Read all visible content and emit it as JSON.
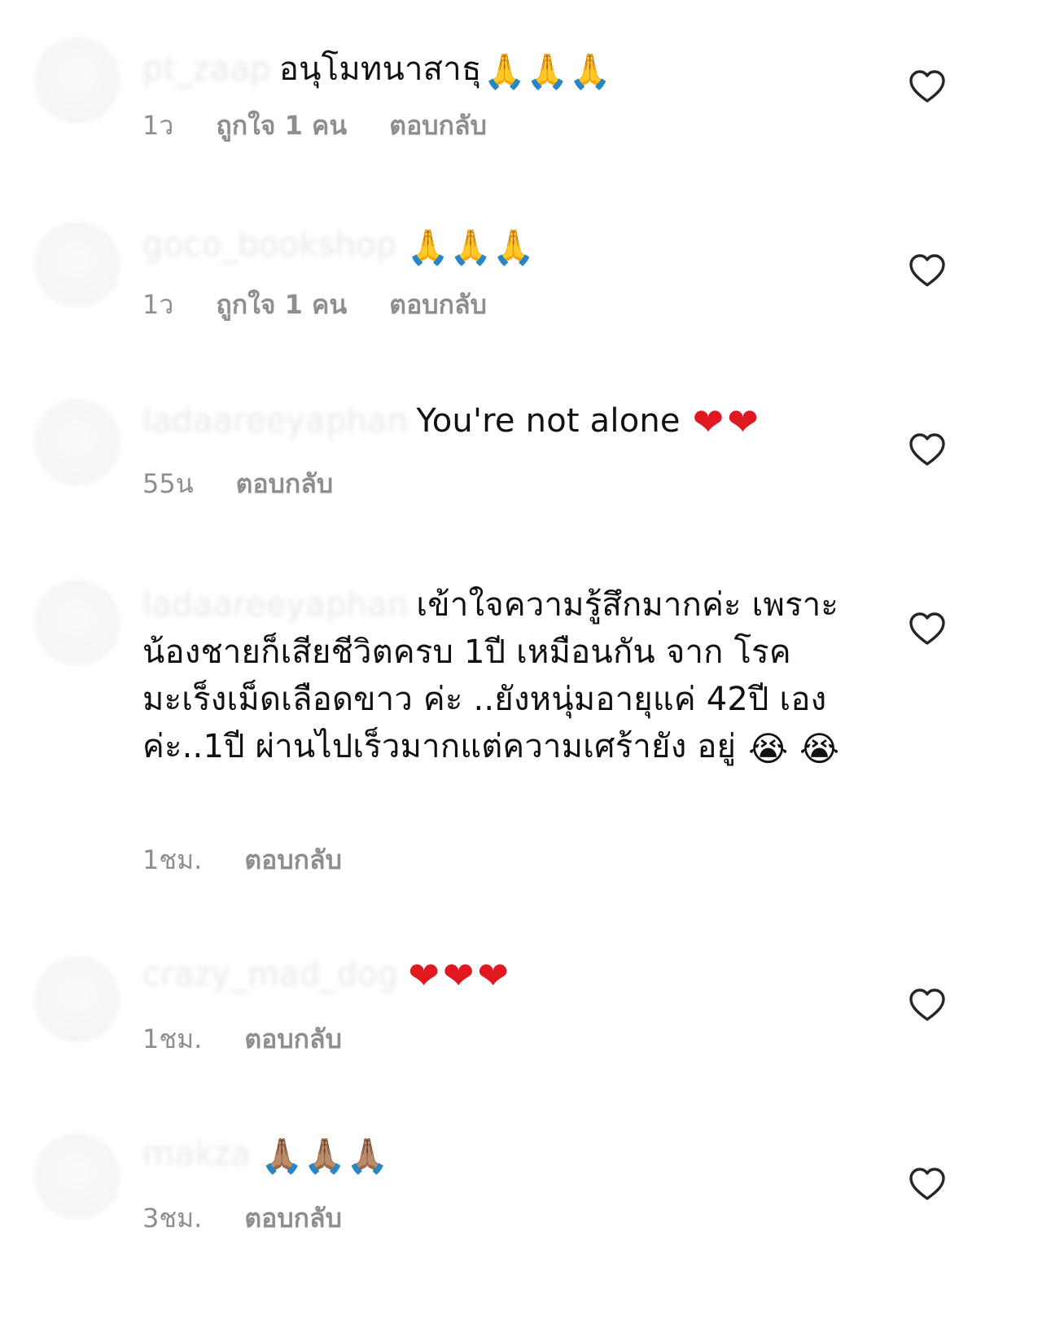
{
  "comments": [
    {
      "username": "pt_zaap",
      "text": "อนุโมทนาสาธุ",
      "emoji": "🙏🙏🙏",
      "time": "1ว",
      "likes": "ถูกใจ 1 คน",
      "reply": "ตอบกลับ"
    },
    {
      "username": "goco_bookshop",
      "text": "",
      "emoji": "🙏🙏🙏",
      "time": "1ว",
      "likes": "ถูกใจ 1 คน",
      "reply": "ตอบกลับ"
    },
    {
      "username": "ladaareeyaphan",
      "text": "You're not alone",
      "emoji": "❤❤",
      "time": "55น",
      "likes": "",
      "reply": "ตอบกลับ"
    },
    {
      "username": "ladaareeyaphan",
      "text": "เข้าใจความรู้สึกมากค่ะ เพราะน้องชายก็เสียชีวิตครบ 1ปี เหมือนกัน จาก โรค มะเร็งเม็ดเลือดขาว ค่ะ ..ยังหนุ่มอายุแค่ 42ปี เองค่ะ..1ปี ผ่านไปเร็วมากแต่ความเศร้ายัง อยู่",
      "emoji": "😭 😭",
      "time": "1ชม.",
      "likes": "",
      "reply": "ตอบกลับ"
    },
    {
      "username": "crazy_mad_dog",
      "text": "",
      "emoji": "❤❤❤",
      "time": "1ชม.",
      "likes": "",
      "reply": "ตอบกลับ"
    },
    {
      "username": "makza",
      "text": "",
      "emoji": "🙏🏽🙏🏽🙏🏽",
      "time": "3ชม.",
      "likes": "",
      "reply": "ตอบกลับ"
    }
  ],
  "icons": {
    "like": "heart-outline-icon"
  },
  "colors": {
    "meta": "#8e8e8e",
    "text": "#111111",
    "heart_emoji": "#e0181f"
  }
}
